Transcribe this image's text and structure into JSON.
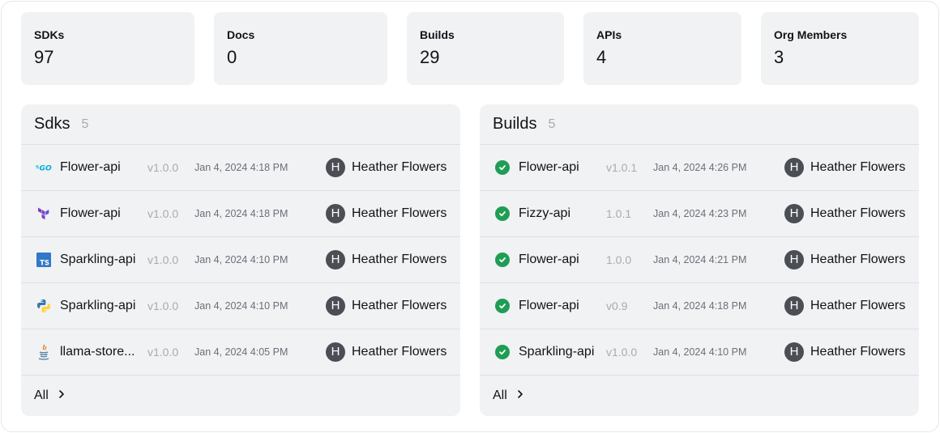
{
  "stats": [
    {
      "label": "SDKs",
      "value": "97"
    },
    {
      "label": "Docs",
      "value": "0"
    },
    {
      "label": "Builds",
      "value": "29"
    },
    {
      "label": "APIs",
      "value": "4"
    },
    {
      "label": "Org Members",
      "value": "3"
    }
  ],
  "sdks_panel": {
    "title": "Sdks",
    "count": "5",
    "rows": [
      {
        "icon": "go-icon",
        "name": "Flower-api",
        "version": "v1.0.0",
        "date": "Jan 4, 2024 4:18 PM",
        "avatar": "H",
        "user": "Heather Flowers"
      },
      {
        "icon": "terraform-icon",
        "name": "Flower-api",
        "version": "v1.0.0",
        "date": "Jan 4, 2024 4:18 PM",
        "avatar": "H",
        "user": "Heather Flowers"
      },
      {
        "icon": "typescript-icon",
        "name": "Sparkling-api",
        "version": "v1.0.0",
        "date": "Jan 4, 2024 4:10 PM",
        "avatar": "H",
        "user": "Heather Flowers"
      },
      {
        "icon": "python-icon",
        "name": "Sparkling-api",
        "version": "v1.0.0",
        "date": "Jan 4, 2024 4:10 PM",
        "avatar": "H",
        "user": "Heather Flowers"
      },
      {
        "icon": "java-icon",
        "name": "llama-store...",
        "version": "v1.0.0",
        "date": "Jan 4, 2024 4:05 PM",
        "avatar": "H",
        "user": "Heather Flowers"
      }
    ],
    "footer_label": "All",
    "typescript_icon_text": "TS",
    "go_icon_text": "GO"
  },
  "builds_panel": {
    "title": "Builds",
    "count": "5",
    "rows": [
      {
        "icon": "success-check-icon",
        "name": "Flower-api",
        "version": "v1.0.1",
        "date": "Jan 4, 2024 4:26 PM",
        "avatar": "H",
        "user": "Heather Flowers"
      },
      {
        "icon": "success-check-icon",
        "name": "Fizzy-api",
        "version": "1.0.1",
        "date": "Jan 4, 2024 4:23 PM",
        "avatar": "H",
        "user": "Heather Flowers"
      },
      {
        "icon": "success-check-icon",
        "name": "Flower-api",
        "version": "1.0.0",
        "date": "Jan 4, 2024 4:21 PM",
        "avatar": "H",
        "user": "Heather Flowers"
      },
      {
        "icon": "success-check-icon",
        "name": "Flower-api",
        "version": "v0.9",
        "date": "Jan 4, 2024 4:18 PM",
        "avatar": "H",
        "user": "Heather Flowers"
      },
      {
        "icon": "success-check-icon",
        "name": "Sparkling-api",
        "version": "v1.0.0",
        "date": "Jan 4, 2024 4:10 PM",
        "avatar": "H",
        "user": "Heather Flowers"
      }
    ],
    "footer_label": "All"
  },
  "colors": {
    "card_bg": "#f1f2f4",
    "success": "#1f9d55",
    "muted": "#a8abb2",
    "avatar_bg": "#4b4e55"
  }
}
